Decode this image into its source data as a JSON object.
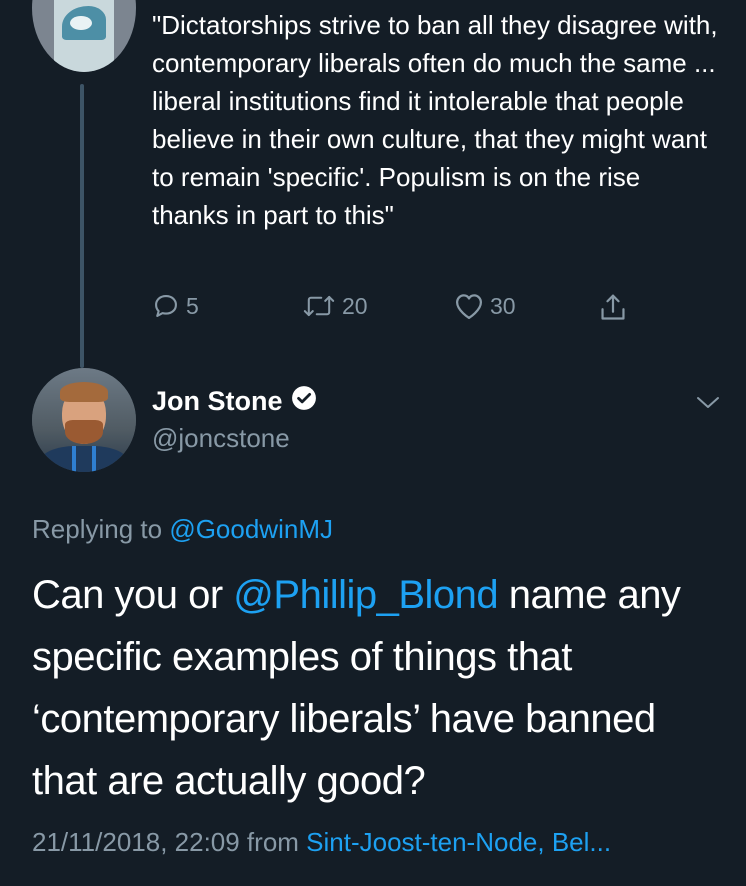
{
  "parent_tweet": {
    "text": "\"Dictatorships strive to ban all they disagree with, contemporary liberals often do much the same ... liberal institutions find it intolerable that people believe in their own culture, that they might want to remain 'specific'. Populism is on the rise thanks in part to this\"",
    "replies": "5",
    "retweets": "20",
    "likes": "30"
  },
  "main_tweet": {
    "display_name": "Jon Stone",
    "handle": "@joncstone",
    "replying_prefix": "Replying to",
    "replying_to": "@GoodwinMJ",
    "body_part1": "Can you or ",
    "body_mention": "@Phillip_Blond",
    "body_part2": "  name any specific examples of things that ‘contemporary liberals’ have banned that are actually good?",
    "timestamp": "21/11/2018, 22:09 from ",
    "location": "Sint-Joost-ten-Node, Bel..."
  },
  "icons": {
    "reply": "reply-icon",
    "retweet": "retweet-icon",
    "like": "heart-icon",
    "share": "share-icon",
    "verified": "verified-badge-icon",
    "menu": "chevron-down-icon"
  },
  "colors": {
    "background": "#141d26",
    "text": "#ffffff",
    "muted": "#8899a6",
    "link": "#1da1f2"
  }
}
